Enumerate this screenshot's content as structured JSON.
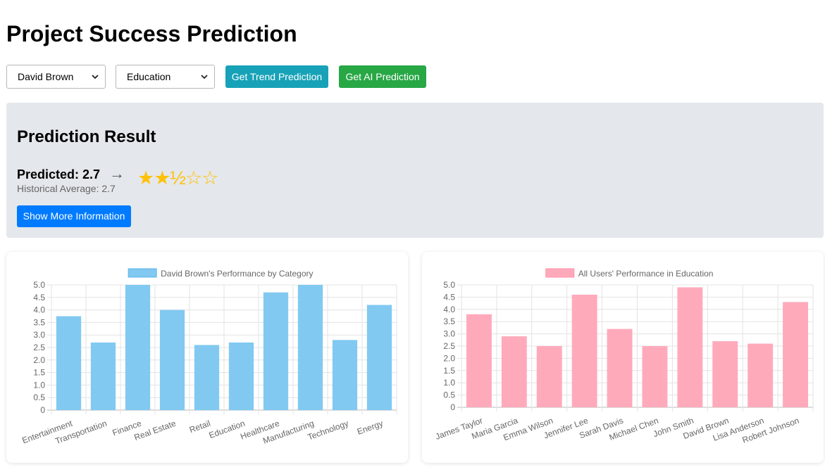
{
  "page": {
    "title": "Project Success Prediction"
  },
  "controls": {
    "user_select": "David Brown",
    "category_select": "Education",
    "trend_button": "Get Trend Prediction",
    "ai_button": "Get AI Prediction"
  },
  "result": {
    "heading": "Prediction Result",
    "predicted": "Predicted: 2.7",
    "arrow": "→",
    "historical": "Historical Average: 2.7",
    "rating": 2.5,
    "stars": "★★½☆☆",
    "more_button": "Show More Information"
  },
  "colors": {
    "teal": "#17a2b8",
    "green": "#28a745",
    "blue": "#007bff",
    "star": "#ffc107",
    "bar_blue": "#81c9f1",
    "bar_pink": "#ffaabb"
  },
  "chart_data": [
    {
      "type": "bar",
      "legend": "David Brown's Performance by Category",
      "categories": [
        "Entertainment",
        "Transportation",
        "Finance",
        "Real Estate",
        "Retail",
        "Education",
        "Healthcare",
        "Manufacturing",
        "Technology",
        "Energy"
      ],
      "values": [
        3.75,
        2.7,
        5.0,
        4.0,
        2.6,
        2.7,
        4.7,
        5.0,
        2.8,
        4.2
      ],
      "ylim": [
        0,
        5
      ],
      "yticks": [
        "0",
        "0.5",
        "1.0",
        "1.5",
        "2.0",
        "2.5",
        "3.0",
        "3.5",
        "4.0",
        "4.5",
        "5.0"
      ],
      "grid": true,
      "legend_position": "top"
    },
    {
      "type": "bar",
      "legend": "All Users' Performance in Education",
      "categories": [
        "James Taylor",
        "Maria Garcia",
        "Emma Wilson",
        "Jennifer Lee",
        "Sarah Davis",
        "Michael Chen",
        "John Smith",
        "David Brown",
        "Lisa Anderson",
        "Robert Johnson"
      ],
      "values": [
        3.8,
        2.9,
        2.5,
        4.6,
        3.2,
        2.5,
        4.9,
        2.7,
        2.6,
        4.3
      ],
      "ylim": [
        0,
        5
      ],
      "yticks": [
        "0",
        "0.5",
        "1.0",
        "1.5",
        "2.0",
        "2.5",
        "3.0",
        "3.5",
        "4.0",
        "4.5",
        "5.0"
      ],
      "grid": true,
      "legend_position": "top"
    }
  ]
}
